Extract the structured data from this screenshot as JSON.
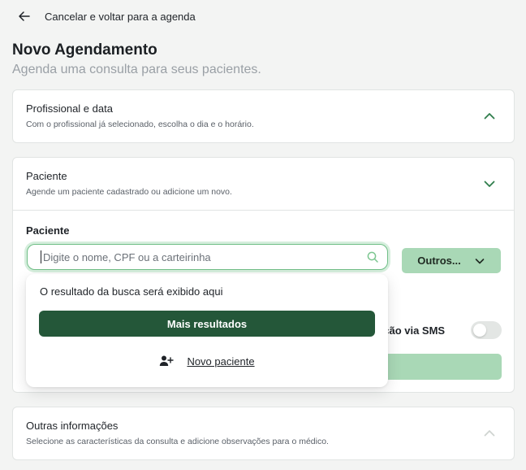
{
  "header": {
    "back_label": "Cancelar e voltar para a agenda",
    "title": "Novo Agendamento",
    "subtitle": "Agenda uma consulta para seus pacientes."
  },
  "sections": {
    "professional": {
      "title": "Profissional e data",
      "description": "Com o profissional já selecionado, escolha o dia e o horário.",
      "expanded_icon": "chevron-up-icon"
    },
    "patient": {
      "title": "Paciente",
      "description": "Agende um paciente cadastrado ou adicione um novo.",
      "expanded_icon": "chevron-down-icon",
      "field_label": "Paciente",
      "search_placeholder": "Digite o nome, CPF ou a carteirinha",
      "search_value": "",
      "others_button": "Outros...",
      "sms_label_partial": "ação via SMS",
      "sms_enabled": false
    },
    "other_info": {
      "title": "Outras informações",
      "description": "Selecione as características da consulta e adicione observações para o médico.",
      "expanded_icon": "chevron-up-icon"
    }
  },
  "search_dropdown": {
    "empty_text": "O resultado da busca será exibido aqui",
    "more_results": "Mais resultados",
    "new_patient": "Novo paciente",
    "new_patient_icon": "add-user-icon"
  },
  "colors": {
    "accent_dark": "#245739",
    "accent_light": "#a9d8b6",
    "focus_border": "#6fbf86"
  }
}
